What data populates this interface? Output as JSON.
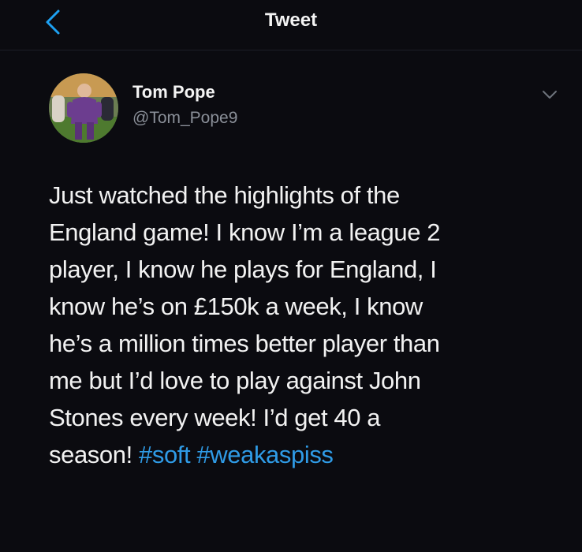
{
  "header": {
    "title": "Tweet",
    "back_icon": "chevron-left-icon"
  },
  "tweet": {
    "author": {
      "display_name": "Tom Pope",
      "handle": "@Tom_Pope9"
    },
    "menu_icon": "chevron-down-icon",
    "text_lines": [
      "Just watched the highlights of the",
      "England game! I know I’m a league 2",
      "player, I know he plays for England, I",
      "know he’s on £150k a week, I know",
      "he’s a million times better player than",
      "me but I’d love to play against John",
      "Stones every week! I’d get 40 a",
      "season!"
    ],
    "hashtags": [
      "#soft",
      "#weakaspiss"
    ]
  },
  "colors": {
    "background": "#0b0b10",
    "text": "#f2f2f2",
    "secondary": "#8a8f98",
    "link": "#2f9be6",
    "accent": "#1da1f2"
  }
}
